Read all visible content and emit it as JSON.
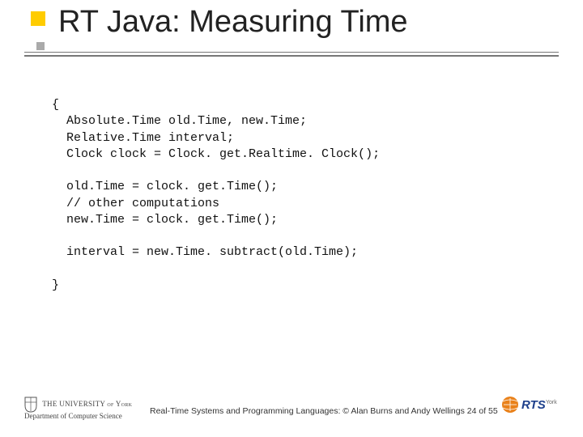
{
  "slide": {
    "title": "RT Java: Measuring Time"
  },
  "code": {
    "l1": "{",
    "l2": "  Absolute.Time old.Time, new.Time;",
    "l3": "  Relative.Time interval;",
    "l4": "  Clock clock = Clock. get.Realtime. Clock();",
    "l5": "",
    "l6": "  old.Time = clock. get.Time();",
    "l7": "  // other computations",
    "l8": "  new.Time = clock. get.Time();",
    "l9": "",
    "l10": "  interval = new.Time. subtract(old.Time);",
    "l11": "",
    "l12": "}"
  },
  "footer": {
    "univ_line1": "THE UNIVERSITY of York",
    "univ_line2": "Department of Computer Science",
    "text": "Real-Time Systems and Programming Languages: © Alan Burns and Andy Wellings 24 of 55",
    "rts_label": "RTS",
    "rts_sub": "York"
  }
}
